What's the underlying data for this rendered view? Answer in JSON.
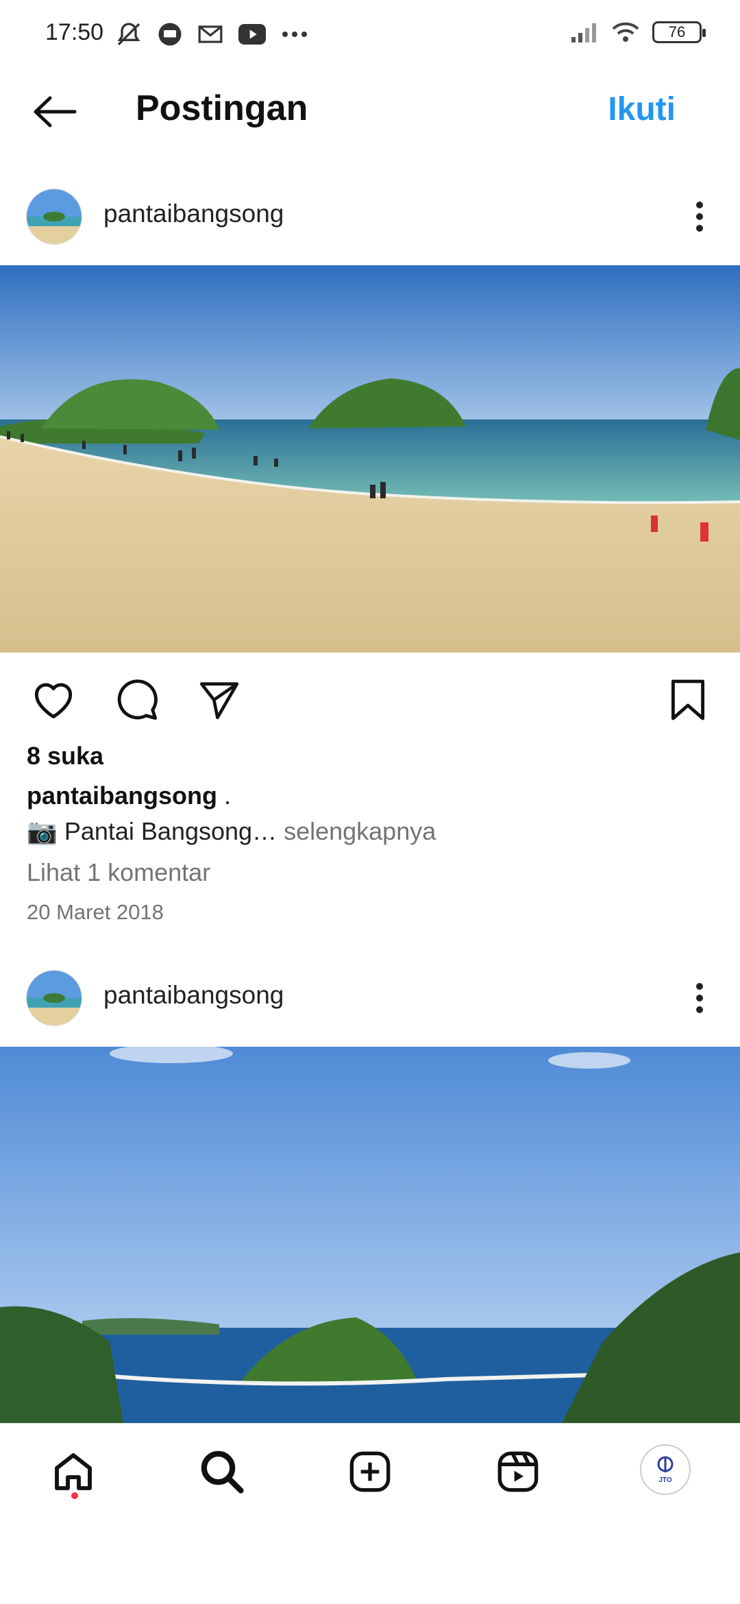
{
  "status_bar": {
    "time": "17:50",
    "battery": "76"
  },
  "header": {
    "title": "Postingan",
    "follow_label": "Ikuti"
  },
  "posts": [
    {
      "username": "pantaibangsong",
      "likes": "8 suka",
      "caption_user": "pantaibangsong",
      "caption_dot": ".",
      "caption_emoji": "📷",
      "caption_text": " Pantai Bangsong…",
      "caption_more": " selengkapnya",
      "comments": "Lihat 1 komentar",
      "date": "20 Maret 2018"
    },
    {
      "username": "pantaibangsong"
    }
  ],
  "bottom_nav": {
    "items": [
      "home-icon",
      "search-icon",
      "add-post-icon",
      "reels-icon",
      "profile-avatar"
    ],
    "profile_text": "JTO"
  },
  "colors": {
    "accent": "#2196f3",
    "notification_dot": "#ff3040"
  }
}
